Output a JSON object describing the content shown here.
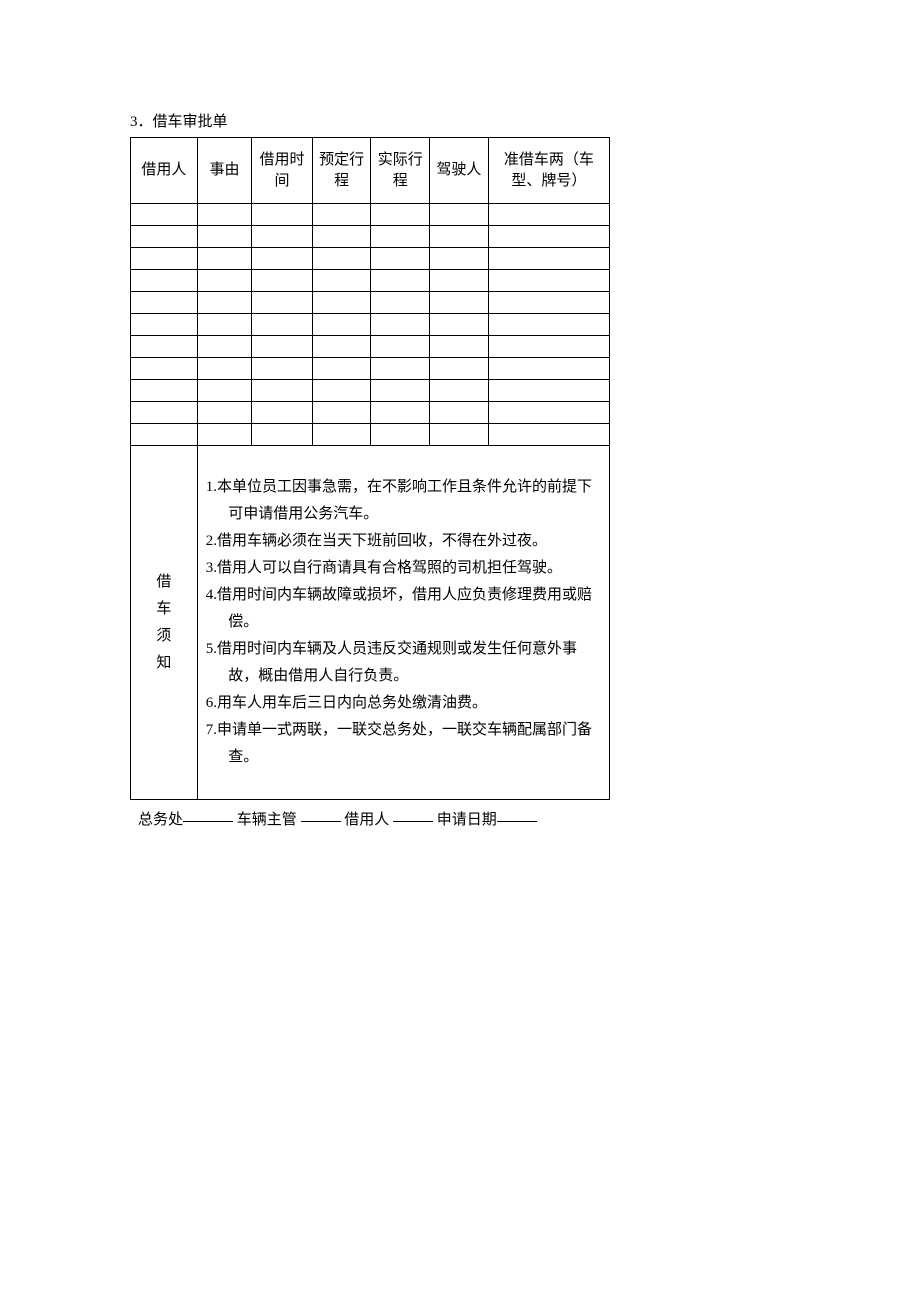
{
  "title": "3．借车审批单",
  "table": {
    "headers": [
      "借用人",
      "事由",
      "借用时间",
      "预定行程",
      "实际行程",
      "驾驶人",
      "准借车两（车型、牌号）"
    ]
  },
  "notice": {
    "label": "借车须知",
    "items": [
      "1.本单位员工因事急需，在不影响工作且条件允许的前提下可申请借用公务汽车。",
      "2.借用车辆必须在当天下班前回收，不得在外过夜。",
      "3.借用人可以自行商请具有合格驾照的司机担任驾驶。",
      "4.借用时间内车辆故障或损坏，借用人应负责修理费用或赔偿。",
      "5.借用时间内车辆及人员违反交通规则或发生任何意外事故，概由借用人自行负责。",
      "6.用车人用车后三日内向总务处缴清油费。",
      "7.申请单一式两联，一联交总务处，一联交车辆配属部门备查。"
    ]
  },
  "footer": {
    "label1": "总务处",
    "label2": "车辆主管",
    "label3": "借用人",
    "label4": "申请日期"
  }
}
